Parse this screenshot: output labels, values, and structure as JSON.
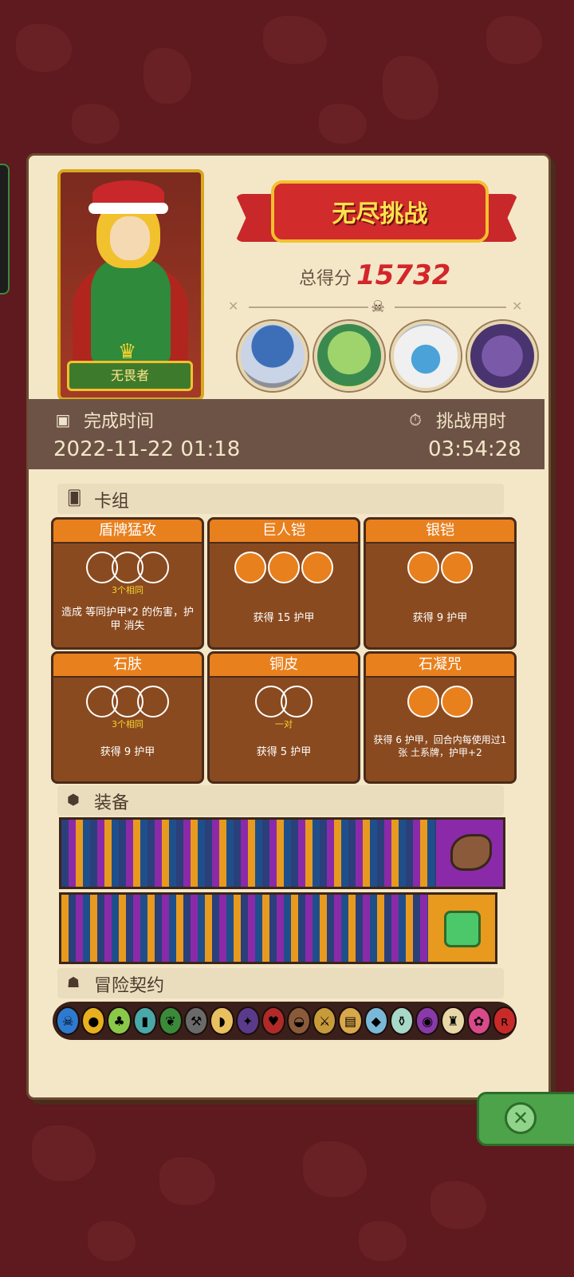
{
  "header": {
    "title": "无尽挑战",
    "score_label": "总得分",
    "score_value": "15732",
    "hero_name": "无畏者"
  },
  "time": {
    "completion_label": "完成时间",
    "completion_value": "2022-11-22 01:18",
    "duration_label": "挑战用时",
    "duration_value": "03:54:28"
  },
  "sections": {
    "deck": "卡组",
    "equipment": "装备",
    "contract": "冒险契约"
  },
  "cards": [
    {
      "name": "盾牌猛攻",
      "sub": "3个相同",
      "desc": "造成 等同护甲*2 的伤害，护甲 消失"
    },
    {
      "name": "巨人铠",
      "sub": "",
      "desc": "获得 15 护甲"
    },
    {
      "name": "银铠",
      "sub": "",
      "desc": "获得 9 护甲"
    },
    {
      "name": "石肤",
      "sub": "3个相同",
      "desc": "获得 9 护甲"
    },
    {
      "name": "铜皮",
      "sub": "一对",
      "desc": "获得 5 护甲"
    },
    {
      "name": "石凝咒",
      "sub": "",
      "desc": "获得 6 护甲，回合内每使用过1张 土系牌，护甲+2"
    }
  ],
  "colors": {
    "bg": "#5e1a1e",
    "card_header": "#e8801e",
    "card_body": "#8a4a1f",
    "score": "#d3262a",
    "accent_gold": "#f2c12e"
  },
  "icons": {
    "completion": "film-icon",
    "duration": "stopwatch-icon",
    "deck": "cards-icon",
    "equipment": "cube-icon",
    "contract": "person-icon",
    "close": "close-icon"
  }
}
